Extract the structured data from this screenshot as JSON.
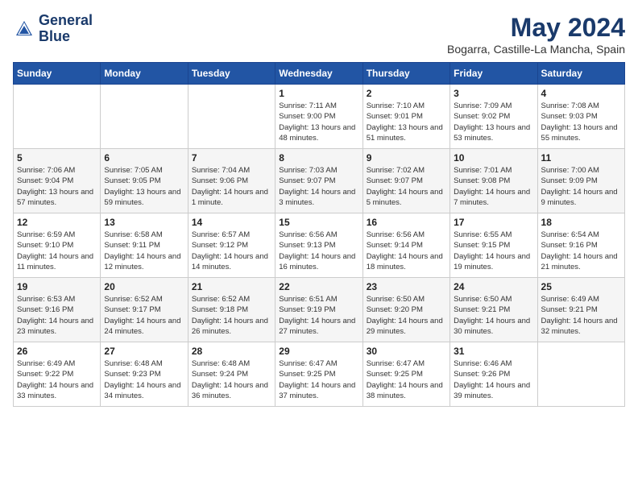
{
  "header": {
    "logo_line1": "General",
    "logo_line2": "Blue",
    "month_year": "May 2024",
    "location": "Bogarra, Castille-La Mancha, Spain"
  },
  "days_of_week": [
    "Sunday",
    "Monday",
    "Tuesday",
    "Wednesday",
    "Thursday",
    "Friday",
    "Saturday"
  ],
  "weeks": [
    [
      {
        "day": "",
        "content": ""
      },
      {
        "day": "",
        "content": ""
      },
      {
        "day": "",
        "content": ""
      },
      {
        "day": "1",
        "content": "Sunrise: 7:11 AM\nSunset: 9:00 PM\nDaylight: 13 hours\nand 48 minutes."
      },
      {
        "day": "2",
        "content": "Sunrise: 7:10 AM\nSunset: 9:01 PM\nDaylight: 13 hours\nand 51 minutes."
      },
      {
        "day": "3",
        "content": "Sunrise: 7:09 AM\nSunset: 9:02 PM\nDaylight: 13 hours\nand 53 minutes."
      },
      {
        "day": "4",
        "content": "Sunrise: 7:08 AM\nSunset: 9:03 PM\nDaylight: 13 hours\nand 55 minutes."
      }
    ],
    [
      {
        "day": "5",
        "content": "Sunrise: 7:06 AM\nSunset: 9:04 PM\nDaylight: 13 hours\nand 57 minutes."
      },
      {
        "day": "6",
        "content": "Sunrise: 7:05 AM\nSunset: 9:05 PM\nDaylight: 13 hours\nand 59 minutes."
      },
      {
        "day": "7",
        "content": "Sunrise: 7:04 AM\nSunset: 9:06 PM\nDaylight: 14 hours\nand 1 minute."
      },
      {
        "day": "8",
        "content": "Sunrise: 7:03 AM\nSunset: 9:07 PM\nDaylight: 14 hours\nand 3 minutes."
      },
      {
        "day": "9",
        "content": "Sunrise: 7:02 AM\nSunset: 9:07 PM\nDaylight: 14 hours\nand 5 minutes."
      },
      {
        "day": "10",
        "content": "Sunrise: 7:01 AM\nSunset: 9:08 PM\nDaylight: 14 hours\nand 7 minutes."
      },
      {
        "day": "11",
        "content": "Sunrise: 7:00 AM\nSunset: 9:09 PM\nDaylight: 14 hours\nand 9 minutes."
      }
    ],
    [
      {
        "day": "12",
        "content": "Sunrise: 6:59 AM\nSunset: 9:10 PM\nDaylight: 14 hours\nand 11 minutes."
      },
      {
        "day": "13",
        "content": "Sunrise: 6:58 AM\nSunset: 9:11 PM\nDaylight: 14 hours\nand 12 minutes."
      },
      {
        "day": "14",
        "content": "Sunrise: 6:57 AM\nSunset: 9:12 PM\nDaylight: 14 hours\nand 14 minutes."
      },
      {
        "day": "15",
        "content": "Sunrise: 6:56 AM\nSunset: 9:13 PM\nDaylight: 14 hours\nand 16 minutes."
      },
      {
        "day": "16",
        "content": "Sunrise: 6:56 AM\nSunset: 9:14 PM\nDaylight: 14 hours\nand 18 minutes."
      },
      {
        "day": "17",
        "content": "Sunrise: 6:55 AM\nSunset: 9:15 PM\nDaylight: 14 hours\nand 19 minutes."
      },
      {
        "day": "18",
        "content": "Sunrise: 6:54 AM\nSunset: 9:16 PM\nDaylight: 14 hours\nand 21 minutes."
      }
    ],
    [
      {
        "day": "19",
        "content": "Sunrise: 6:53 AM\nSunset: 9:16 PM\nDaylight: 14 hours\nand 23 minutes."
      },
      {
        "day": "20",
        "content": "Sunrise: 6:52 AM\nSunset: 9:17 PM\nDaylight: 14 hours\nand 24 minutes."
      },
      {
        "day": "21",
        "content": "Sunrise: 6:52 AM\nSunset: 9:18 PM\nDaylight: 14 hours\nand 26 minutes."
      },
      {
        "day": "22",
        "content": "Sunrise: 6:51 AM\nSunset: 9:19 PM\nDaylight: 14 hours\nand 27 minutes."
      },
      {
        "day": "23",
        "content": "Sunrise: 6:50 AM\nSunset: 9:20 PM\nDaylight: 14 hours\nand 29 minutes."
      },
      {
        "day": "24",
        "content": "Sunrise: 6:50 AM\nSunset: 9:21 PM\nDaylight: 14 hours\nand 30 minutes."
      },
      {
        "day": "25",
        "content": "Sunrise: 6:49 AM\nSunset: 9:21 PM\nDaylight: 14 hours\nand 32 minutes."
      }
    ],
    [
      {
        "day": "26",
        "content": "Sunrise: 6:49 AM\nSunset: 9:22 PM\nDaylight: 14 hours\nand 33 minutes."
      },
      {
        "day": "27",
        "content": "Sunrise: 6:48 AM\nSunset: 9:23 PM\nDaylight: 14 hours\nand 34 minutes."
      },
      {
        "day": "28",
        "content": "Sunrise: 6:48 AM\nSunset: 9:24 PM\nDaylight: 14 hours\nand 36 minutes."
      },
      {
        "day": "29",
        "content": "Sunrise: 6:47 AM\nSunset: 9:25 PM\nDaylight: 14 hours\nand 37 minutes."
      },
      {
        "day": "30",
        "content": "Sunrise: 6:47 AM\nSunset: 9:25 PM\nDaylight: 14 hours\nand 38 minutes."
      },
      {
        "day": "31",
        "content": "Sunrise: 6:46 AM\nSunset: 9:26 PM\nDaylight: 14 hours\nand 39 minutes."
      },
      {
        "day": "",
        "content": ""
      }
    ]
  ]
}
